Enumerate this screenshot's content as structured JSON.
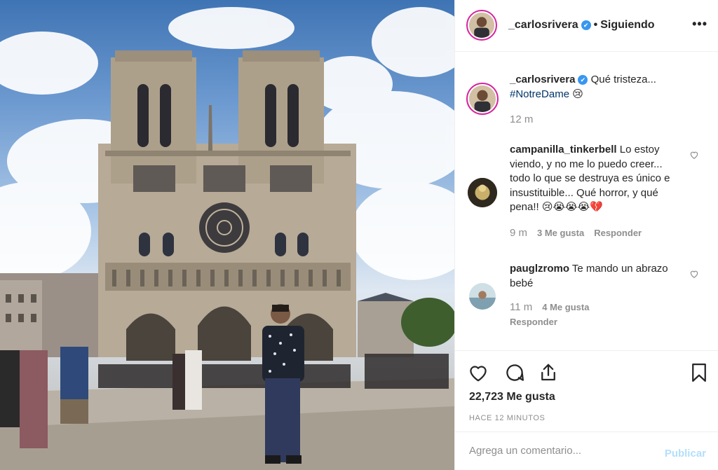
{
  "post": {
    "image_alt": "Catedral de Notre Dame",
    "author": "_carlosrivera",
    "verified_icon": "verified-badge-icon",
    "separator": "•",
    "follow_status": "Siguiendo",
    "more_label": "•••"
  },
  "caption": {
    "user": "_carlosrivera",
    "text": " Qué tristeza... ",
    "hashtag": "#NotreDame",
    "emoji": "😢",
    "time": "12 m"
  },
  "comments": [
    {
      "user": "campanilla_tinkerbell",
      "text": " Lo estoy viendo, y no me lo puedo creer... todo lo que se destruya es único e insustituible... Qué horror, y qué pena!! 😢😭😭😭💔",
      "time": "9 m",
      "likes": "3 Me gusta",
      "reply": "Responder"
    },
    {
      "user": "pauglzromo",
      "text": " Te mando un abrazo bebé",
      "time": "11 m",
      "likes": "4 Me gusta",
      "reply": "Responder"
    }
  ],
  "actions": {
    "icons": [
      "heart-icon",
      "comment-icon",
      "share-icon",
      "bookmark-icon"
    ],
    "likes_count": "22,723 Me gusta",
    "posted": "HACE 12 MINUTOS"
  },
  "comment_box": {
    "placeholder": "Agrega un comentario...",
    "publish_label": "Publicar"
  },
  "colors": {
    "verified": "#3897f0",
    "hashtag": "#003569",
    "publish_disabled": "#b2dffc",
    "muted": "#8e8e8e"
  }
}
